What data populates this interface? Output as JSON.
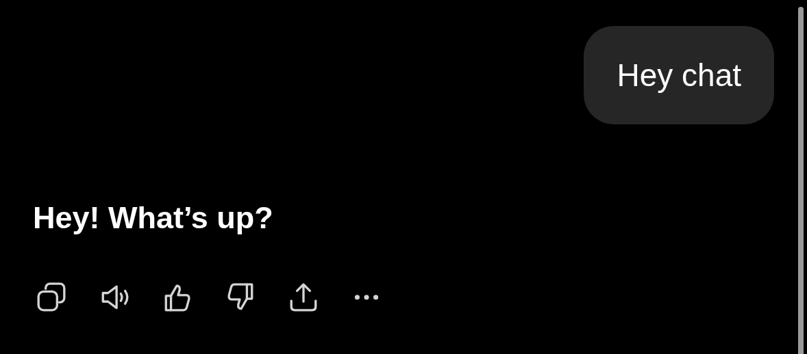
{
  "user_message": {
    "text": "Hey chat"
  },
  "assistant_message": {
    "text": "Hey! What’s up?"
  },
  "message_actions": [
    {
      "kind": "copy"
    },
    {
      "kind": "read-aloud"
    },
    {
      "kind": "like"
    },
    {
      "kind": "dislike"
    },
    {
      "kind": "share"
    },
    {
      "kind": "more"
    }
  ]
}
